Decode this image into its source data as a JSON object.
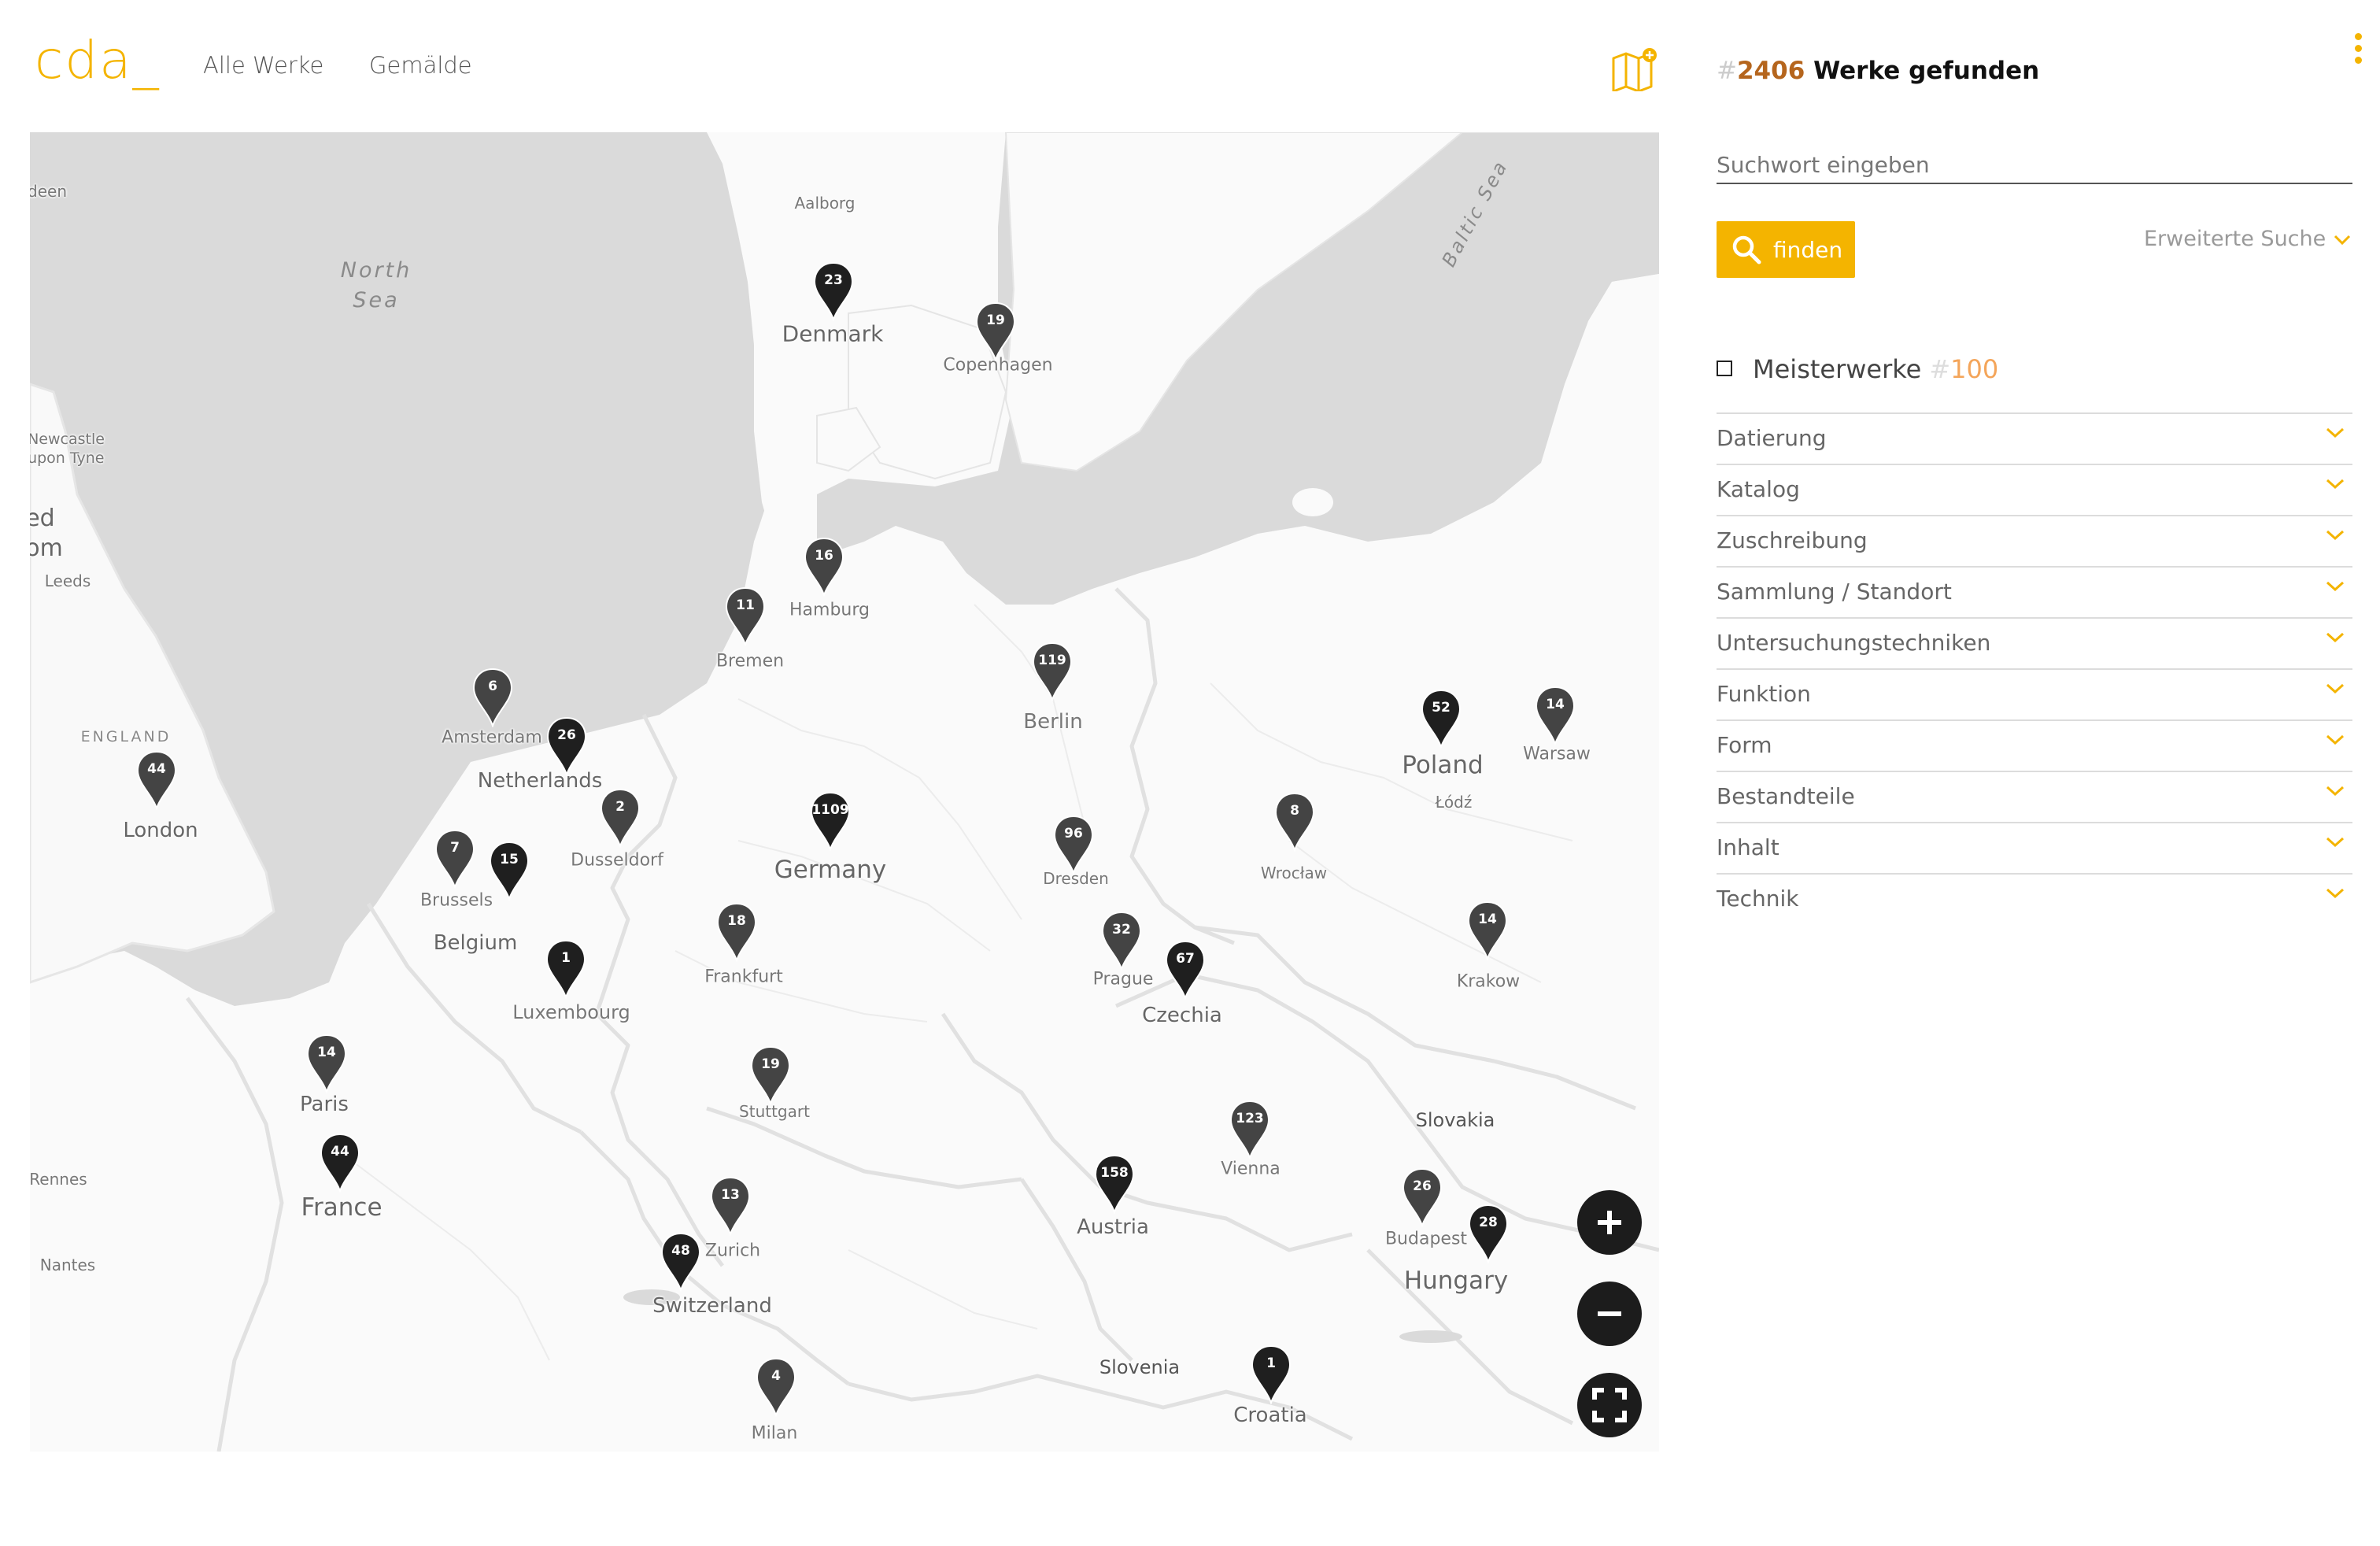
{
  "header": {
    "logo": "cda_",
    "nav": [
      "Alle Werke",
      "Gemälde"
    ],
    "map_icon": "map-plus-icon",
    "menu_icon": "kebab-menu-icon"
  },
  "results": {
    "hash": "#",
    "count": "2406",
    "label": "Werke gefunden"
  },
  "search": {
    "placeholder": "Suchwort eingeben",
    "button_label": "finden",
    "button_icon": "search-icon",
    "advanced_label": "Erweiterte Suche"
  },
  "masterworks": {
    "label": "Meisterwerke",
    "hash": "#",
    "count": "100"
  },
  "facets": [
    {
      "label": "Datierung"
    },
    {
      "label": "Katalog"
    },
    {
      "label": "Zuschreibung"
    },
    {
      "label": "Sammlung / Standort"
    },
    {
      "label": "Untersuchungstechniken"
    },
    {
      "label": "Funktion"
    },
    {
      "label": "Form"
    },
    {
      "label": "Bestandteile"
    },
    {
      "label": "Inhalt"
    },
    {
      "label": "Technik"
    }
  ],
  "map": {
    "controls": [
      "zoom-in-icon",
      "zoom-out-icon",
      "fullscreen-icon"
    ],
    "markers": [
      {
        "count": "23"
      },
      {
        "count": "19"
      },
      {
        "count": "16"
      },
      {
        "count": "11"
      },
      {
        "count": "119"
      },
      {
        "count": "6"
      },
      {
        "count": "26"
      },
      {
        "count": "44"
      },
      {
        "count": "2"
      },
      {
        "count": "1109"
      },
      {
        "count": "96"
      },
      {
        "count": "8"
      },
      {
        "count": "52"
      },
      {
        "count": "14"
      },
      {
        "count": "7"
      },
      {
        "count": "15"
      },
      {
        "count": "18"
      },
      {
        "count": "1"
      },
      {
        "count": "32"
      },
      {
        "count": "67"
      },
      {
        "count": "14"
      },
      {
        "count": "14"
      },
      {
        "count": "19"
      },
      {
        "count": "44"
      },
      {
        "count": "123"
      },
      {
        "count": "158"
      },
      {
        "count": "13"
      },
      {
        "count": "48"
      },
      {
        "count": "26"
      },
      {
        "count": "28"
      },
      {
        "count": "4"
      },
      {
        "count": "1"
      }
    ],
    "labels": {
      "deen": "deen",
      "aalborg": "Aalborg",
      "north_sea": "North\nSea",
      "baltic_sea": "Baltic Sea",
      "denmark": "Denmark",
      "copenhagen": "Copenhagen",
      "newcastle": "Newcastle\nupon Tyne",
      "ed_om": "ed\nom",
      "leeds": "Leeds",
      "hamburg": "Hamburg",
      "bremen": "Bremen",
      "berlin": "Berlin",
      "amsterdam": "Amsterdam",
      "netherlands": "Netherlands",
      "england": "ENGLAND",
      "london": "London",
      "dusseldorf": "Dusseldorf",
      "germany": "Germany",
      "dresden": "Dresden",
      "wroclaw": "Wrocław",
      "poland": "Poland",
      "lodz": "Łódź",
      "warsaw": "Warsaw",
      "brussels": "Brussels",
      "belgium": "Belgium",
      "frankfurt": "Frankfurt",
      "luxembourg": "Luxembourg",
      "prague": "Prague",
      "czechia": "Czechia",
      "krakow": "Krakow",
      "paris": "Paris",
      "stuttgart": "Stuttgart",
      "france": "France",
      "rennes": "Rennes",
      "vienna": "Vienna",
      "slovakia": "Slovakia",
      "austria": "Austria",
      "zurich": "Zurich",
      "switzerland": "Switzerland",
      "nantes": "Nantes",
      "budapest": "Budapest",
      "hungary": "Hungary",
      "slovenia": "Slovenia",
      "milan": "Milan",
      "croatia": "Croatia"
    }
  },
  "colors": {
    "accent": "#f4b400",
    "count": "#b5651d",
    "marker_dark": "#1f1f1f",
    "marker_mid": "#444444"
  }
}
